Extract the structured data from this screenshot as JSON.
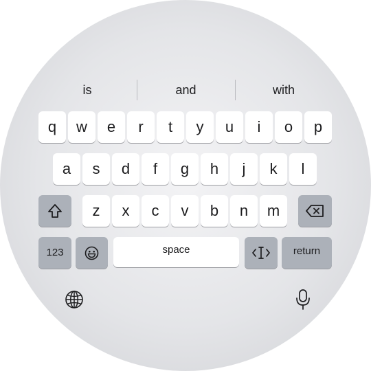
{
  "suggestions": [
    "is",
    "and",
    "with"
  ],
  "keys": {
    "row1": [
      "q",
      "w",
      "e",
      "r",
      "t",
      "y",
      "u",
      "i",
      "o",
      "p"
    ],
    "row2": [
      "a",
      "s",
      "d",
      "f",
      "g",
      "h",
      "j",
      "k",
      "l"
    ],
    "row3": [
      "z",
      "x",
      "c",
      "v",
      "b",
      "n",
      "m"
    ],
    "numbers_label": "123",
    "space_label": "space",
    "return_label": "return"
  },
  "icons": {
    "shift": "shift-icon",
    "delete": "delete-icon",
    "emoji": "emoji-icon",
    "cursor": "text-cursor-icon",
    "globe": "globe-icon",
    "microphone": "microphone-icon"
  },
  "colors": {
    "background_center": "#f3f3f5",
    "background_edge": "#cfd0d4",
    "key_light": "#ffffff",
    "key_dark": "#acb1b9",
    "text": "#1c1c1e"
  }
}
